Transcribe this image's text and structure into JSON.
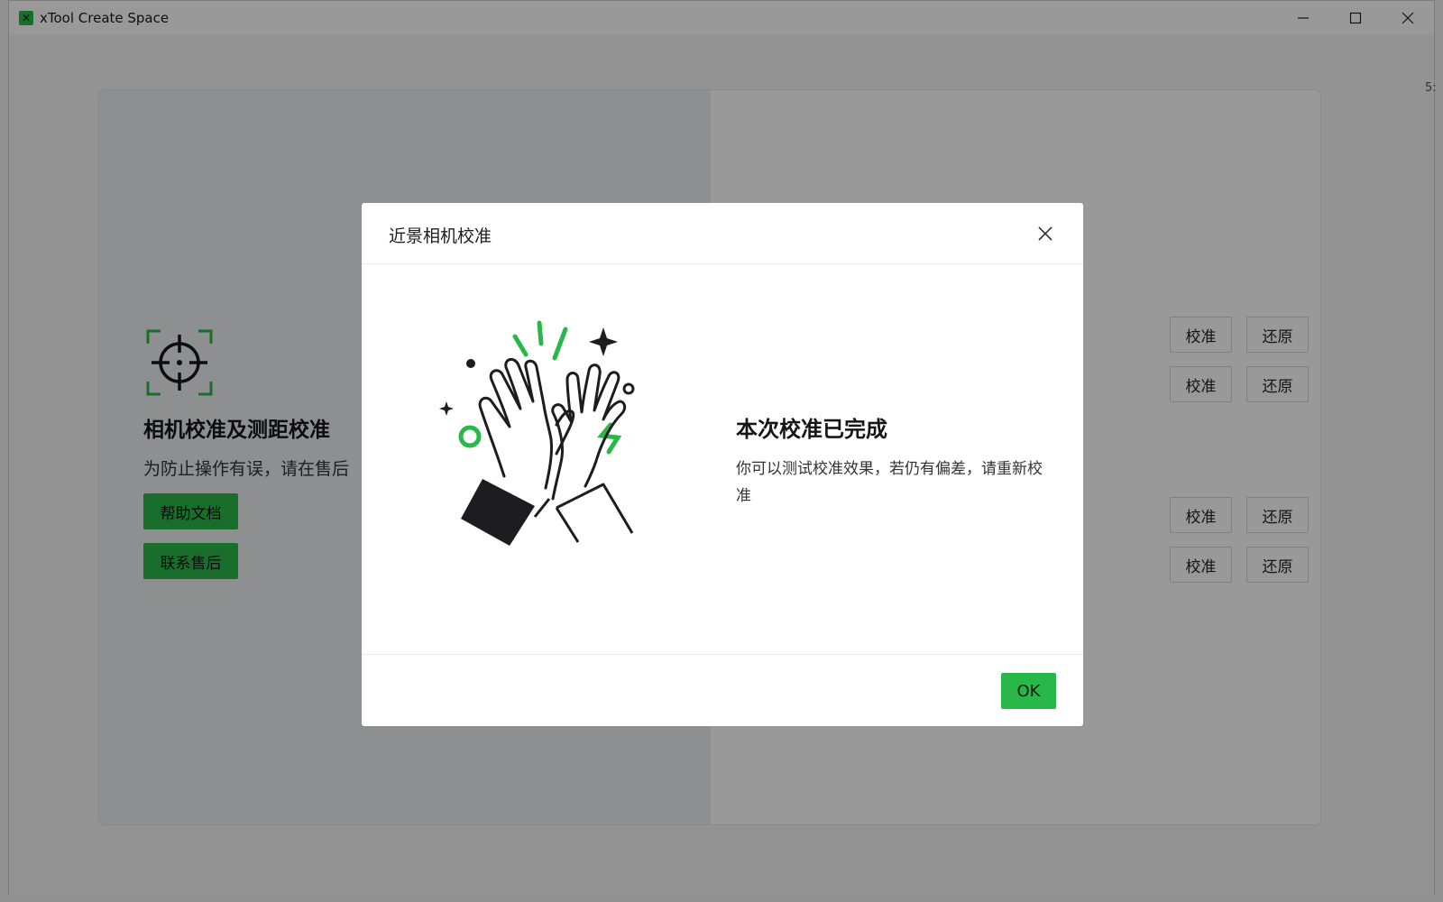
{
  "window": {
    "title": "xTool Create Space",
    "logo_glyph": "✕"
  },
  "calibration_page": {
    "title": "相机校准及测距校准",
    "description": "为防止操作有误，请在售后",
    "help_button": "帮助文档",
    "contact_button": "联系售后",
    "rows": [
      {
        "calibrate_label": "校准",
        "restore_label": "还原"
      },
      {
        "calibrate_label": "校准",
        "restore_label": "还原"
      },
      {
        "calibrate_label": "校准",
        "restore_label": "还原"
      },
      {
        "calibrate_label": "校准",
        "restore_label": "还原"
      }
    ],
    "edge_text": "5:"
  },
  "dialog": {
    "title": "近景相机校准",
    "heading": "本次校准已完成",
    "message": "你可以测试校准效果，若仍有偏差，请重新校准",
    "ok_label": "OK"
  },
  "colors": {
    "accent": "#2ab74a",
    "illustration_dark": "#1c1c21"
  }
}
